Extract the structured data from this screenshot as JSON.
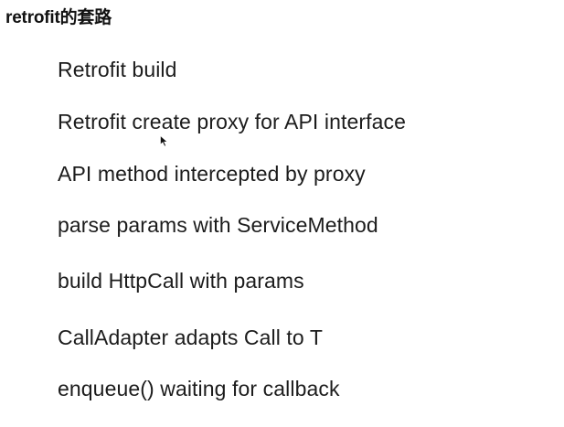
{
  "slide": {
    "title": "retrofit的套路",
    "steps": [
      "Retrofit build",
      "Retrofit create proxy for API interface",
      "API method intercepted by proxy",
      "parse params with ServiceMethod",
      "build HttpCall with params",
      "CallAdapter adapts Call to T",
      "enqueue() waiting for callback"
    ]
  },
  "cursor": {
    "icon": "mouse-pointer-icon",
    "color": "#111111"
  }
}
